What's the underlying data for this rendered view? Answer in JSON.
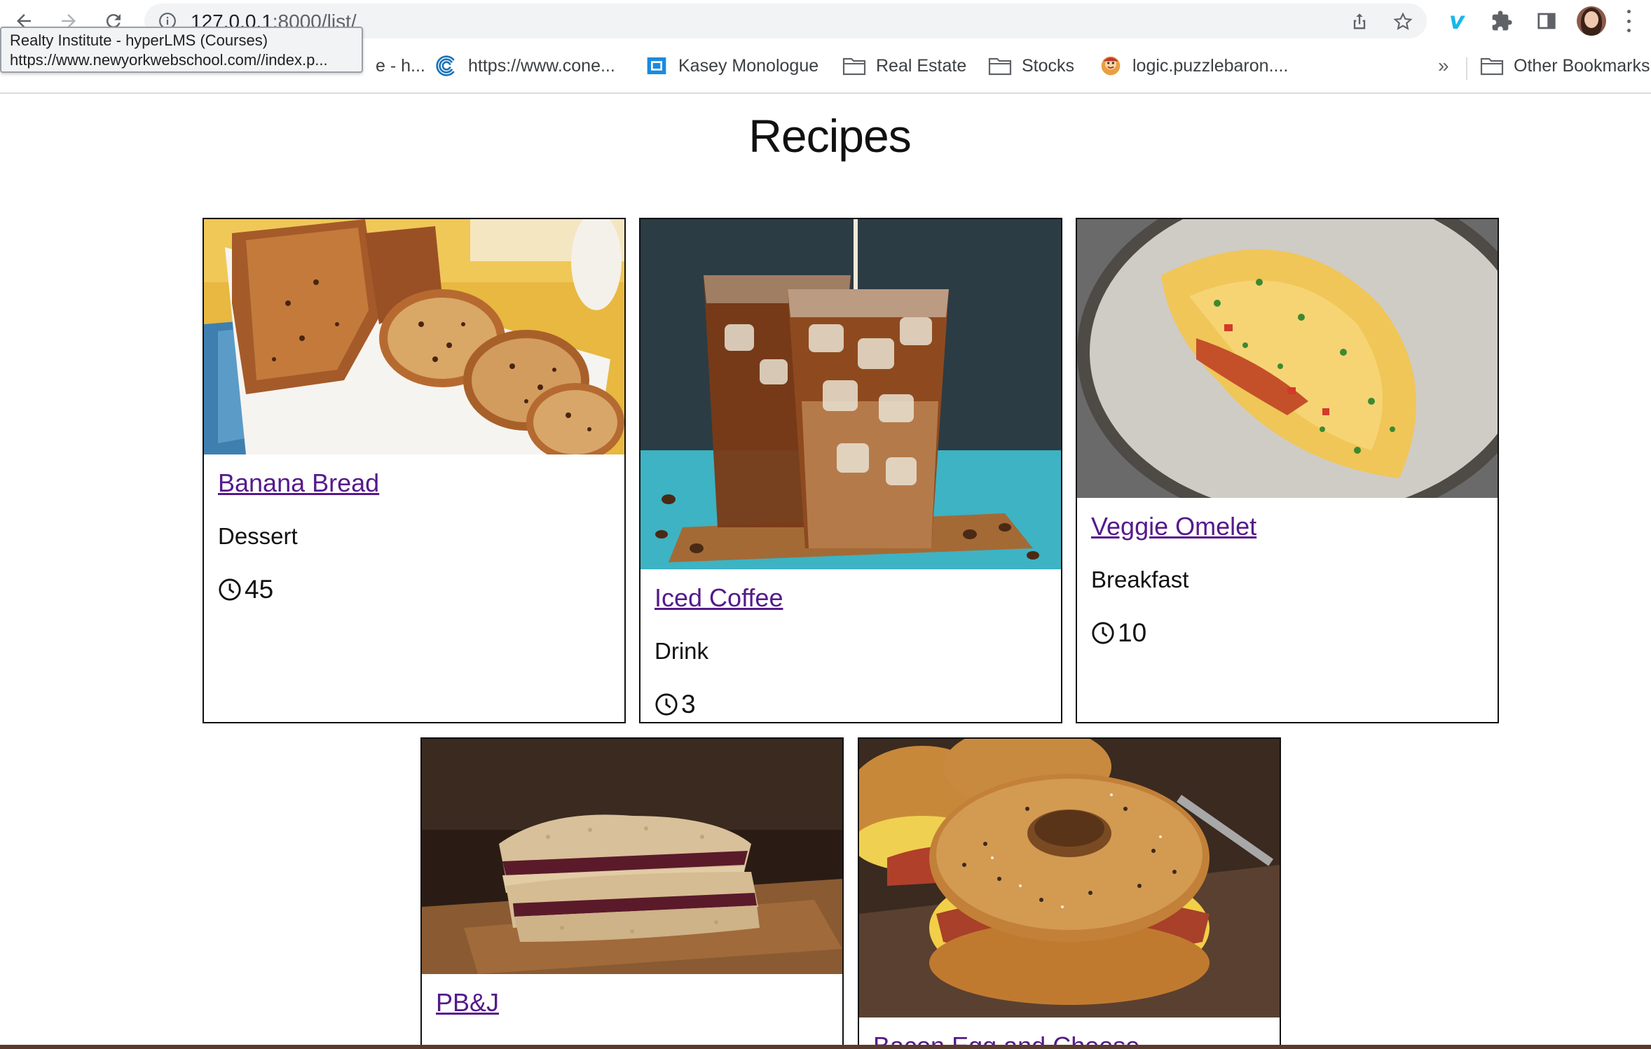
{
  "browser": {
    "url_host": "127.0.0.1",
    "url_path": ":8000/list/",
    "tooltip": {
      "title": "Realty Institute - hyperLMS (Courses)",
      "url": "https://www.newyorkwebschool.com//index.p..."
    },
    "bookmarks": [
      {
        "label": "e - h...",
        "icon": "site-icon"
      },
      {
        "label": "https://www.cone...",
        "icon": "conedison-icon"
      },
      {
        "label": "Kasey Monologue",
        "icon": "video-icon"
      },
      {
        "label": "Real Estate",
        "icon": "folder-icon"
      },
      {
        "label": "Stocks",
        "icon": "folder-icon"
      },
      {
        "label": "logic.puzzlebaron....",
        "icon": "puzzle-site-icon"
      }
    ],
    "overflow_label": "»",
    "other_bookmarks": "Other Bookmarks"
  },
  "page": {
    "title": "Recipes",
    "recipes": [
      {
        "name": "Banana Bread",
        "category": "Dessert",
        "time": "45",
        "image": "banana-bread-photo"
      },
      {
        "name": "Iced Coffee",
        "category": "Drink",
        "time": "3",
        "image": "iced-coffee-photo"
      },
      {
        "name": "Veggie Omelet",
        "category": "Breakfast",
        "time": "10",
        "image": "omelet-photo"
      },
      {
        "name": "PB&J",
        "category": "",
        "time": "",
        "image": "pbj-photo"
      },
      {
        "name": "Bacon Egg and Cheese",
        "category": "",
        "time": "",
        "image": "bagel-sandwich-photo"
      }
    ]
  }
}
